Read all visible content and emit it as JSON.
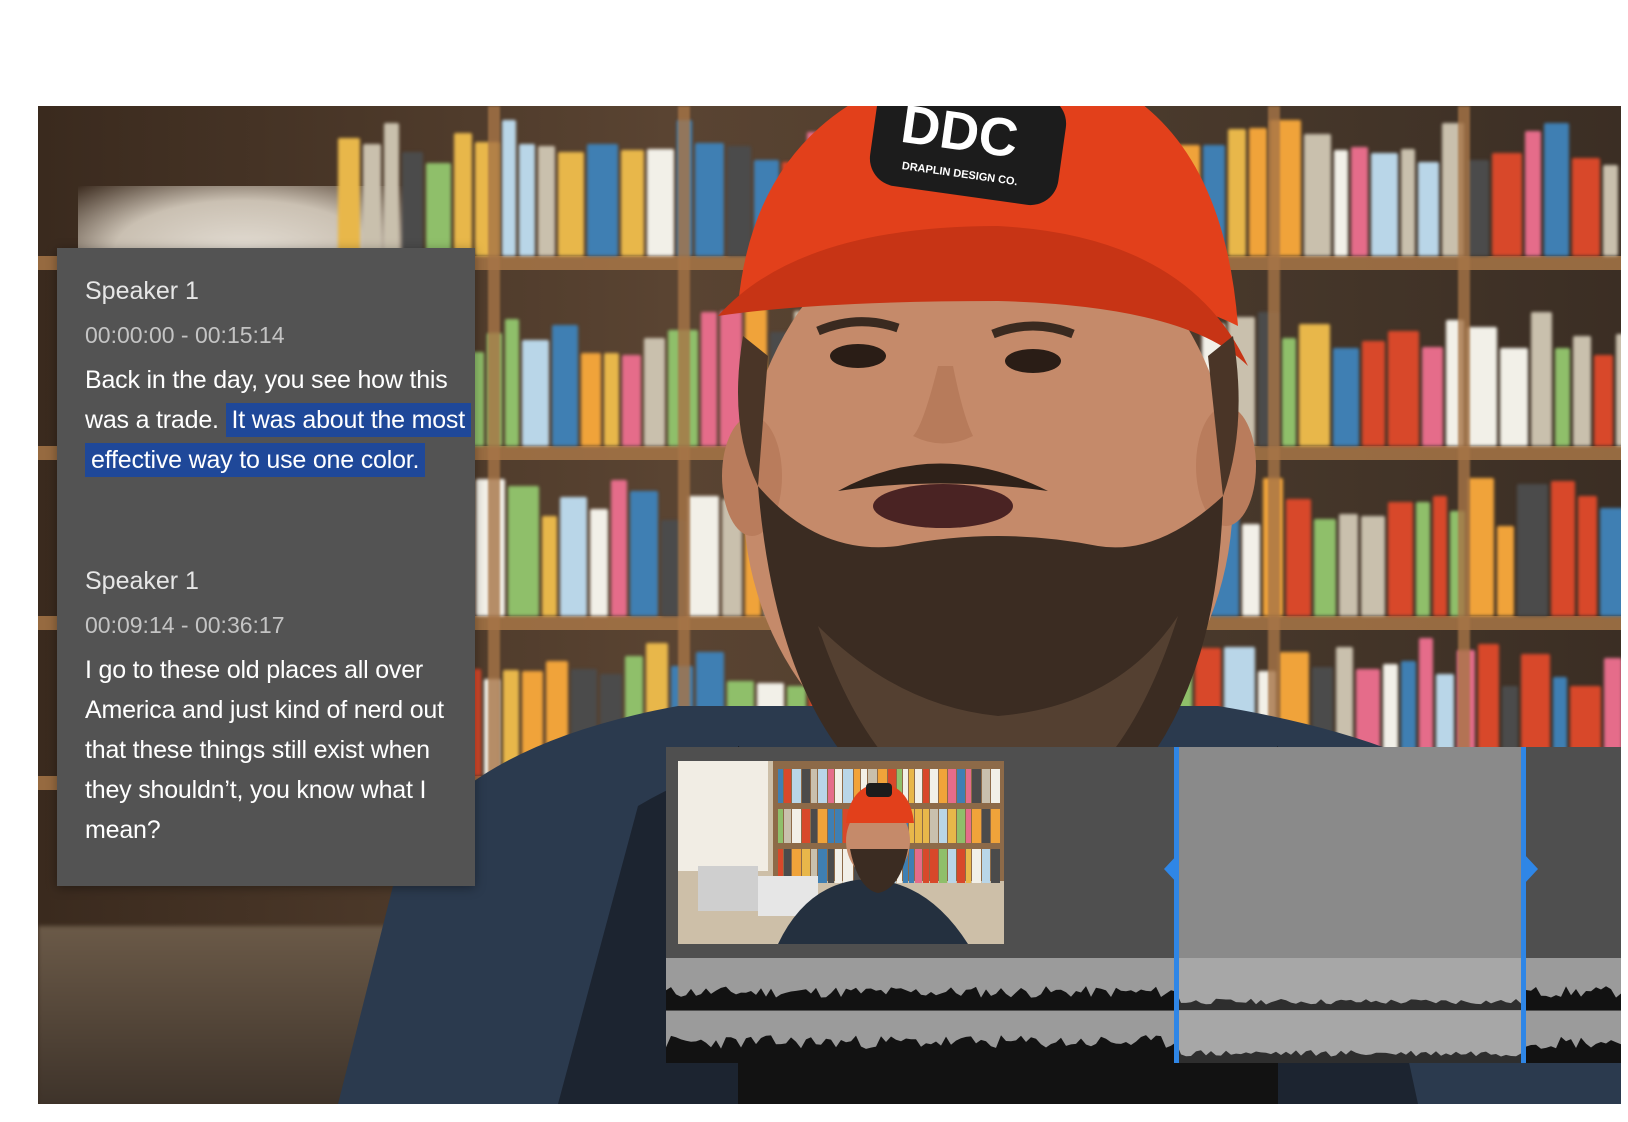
{
  "transcript": {
    "entries": [
      {
        "speaker": "Speaker 1",
        "timecode": "00:00:00 - 00:15:14",
        "text_before": "Back in the day, you see how this was a trade.",
        "text_highlighted": "It was about the most effective way to use one color."
      },
      {
        "speaker": "Speaker 1",
        "timecode": "00:09:14 - 00:36:17",
        "text": "I go to these old places all over America and just kind of nerd out that these things still exist when they shouldn’t, you know what I mean?"
      }
    ]
  },
  "video": {
    "cap_logo_text": "DDC",
    "cap_logo_subtext": "DRAPLIN DESIGN CO."
  },
  "colors": {
    "panel_bg": "#535353",
    "highlight": "#1f4899",
    "selection_handle": "#2f86e6",
    "timeline_bg": "#4f4f4f",
    "selection_bg": "#8a8a8a",
    "cap": "#e2401b"
  }
}
